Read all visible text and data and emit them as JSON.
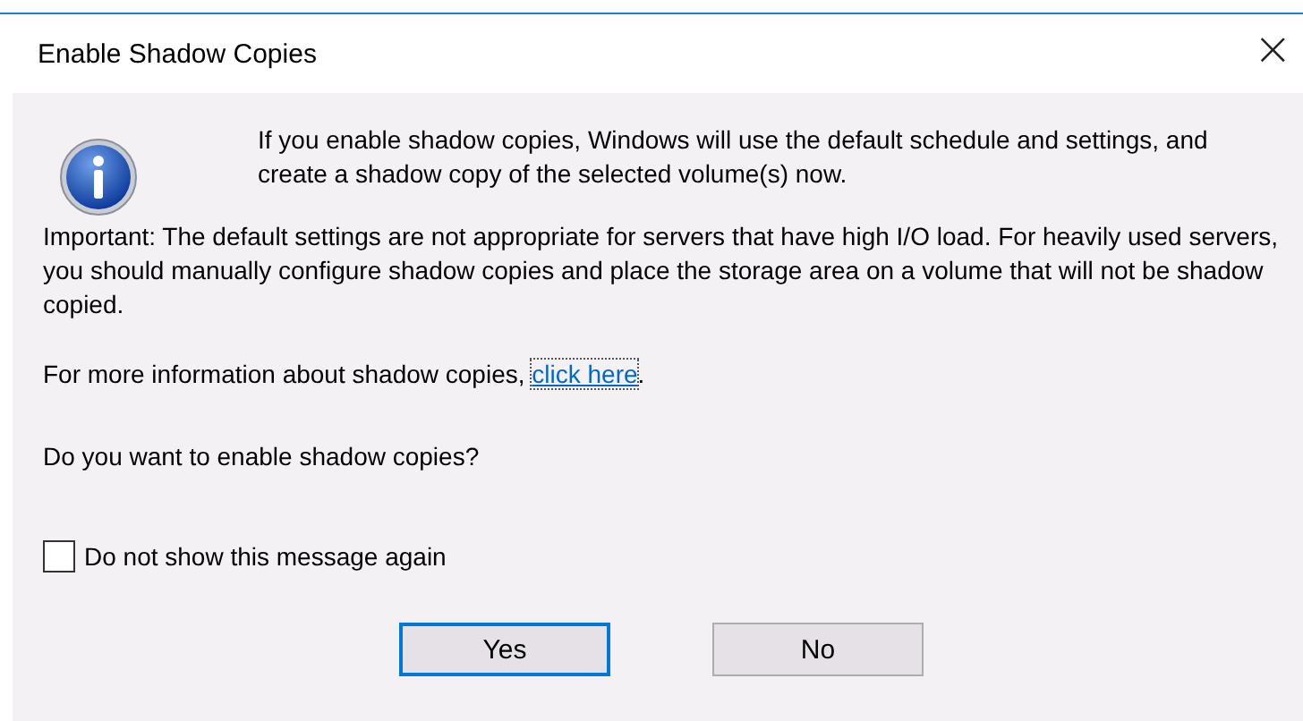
{
  "window": {
    "title": "Enable Shadow Copies",
    "close": "×"
  },
  "message": "If you enable shadow copies, Windows will use the default schedule and settings, and create a shadow copy of the selected volume(s) now.",
  "important": "Important: The default settings are not appropriate for servers that have high I/O load. For heavily used servers, you should manually configure shadow copies and place the storage area on a volume that will not be shadow copied.",
  "more_info": {
    "text": "For more information about shadow copies, ",
    "link": "click here",
    "after": "."
  },
  "question": "Do you want to enable shadow copies?",
  "checkbox": {
    "label": "Do not show this message again",
    "checked": false
  },
  "buttons": [
    {
      "label": "Yes",
      "default": true
    },
    {
      "label": "No",
      "default": false
    }
  ]
}
